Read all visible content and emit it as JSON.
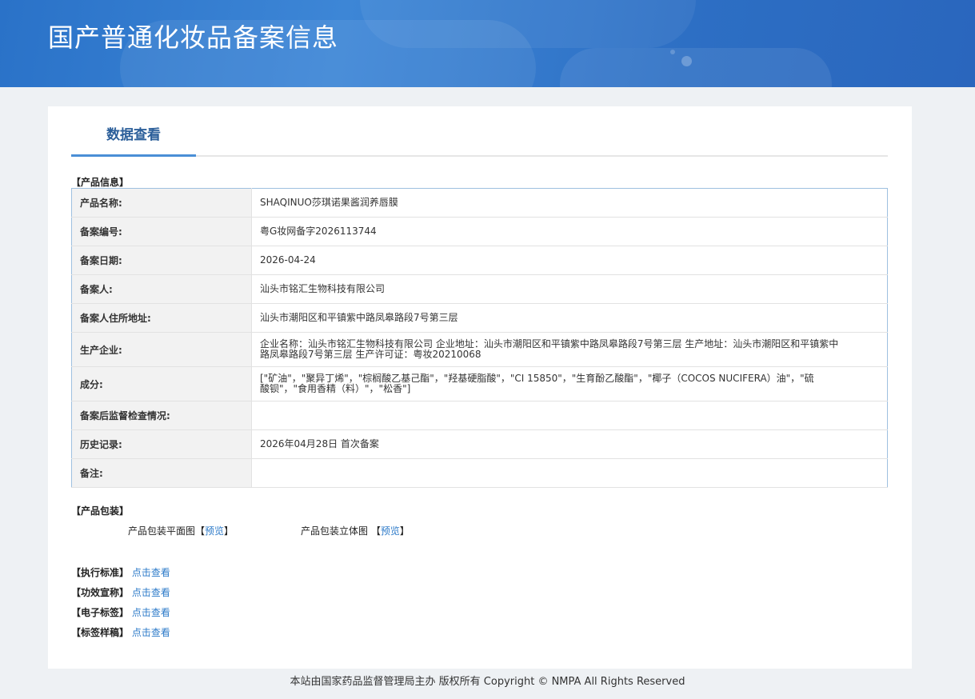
{
  "header": {
    "title": "国产普通化妆品备案信息"
  },
  "tab": {
    "label": "数据查看"
  },
  "sections": {
    "product_info": "【产品信息】",
    "packaging": "【产品包装】"
  },
  "product_table": [
    {
      "key": "产品名称:",
      "value": "SHAQINUO莎琪诺果酱润养唇膜"
    },
    {
      "key": "备案编号:",
      "value": "粤G妆网备字2026113744"
    },
    {
      "key": "备案日期:",
      "value": "2026-04-24"
    },
    {
      "key": "备案人:",
      "value": "汕头市铭汇生物科技有限公司"
    },
    {
      "key": "备案人住所地址:",
      "value": "汕头市潮阳区和平镇紫中路凤皋路段7号第三层"
    },
    {
      "key": "生产企业:",
      "value": "企业名称：汕头市铭汇生物科技有限公司 企业地址：汕头市潮阳区和平镇紫中路凤皋路段7号第三层 生产地址：汕头市潮阳区和平镇紫中路凤皋路段7号第三层 生产许可证：粤妆20210068"
    },
    {
      "key": "成分:",
      "value": "[\"矿油\"，\"聚异丁烯\"，\"棕榈酸乙基己酯\"，\"羟基硬脂酸\"，\"CI 15850\"，\"生育酚乙酸酯\"，\"椰子（COCOS NUCIFERA）油\"，\"硫酸钡\"，\"食用香精（料）\"，\"松香\"]"
    },
    {
      "key": "备案后监督检查情况:",
      "value": ""
    },
    {
      "key": "历史记录:",
      "value": "2026年04月28日 首次备案"
    },
    {
      "key": "备注:",
      "value": ""
    }
  ],
  "packaging": {
    "flat_label": "产品包装平面图",
    "flat_open": "【",
    "flat_link": "预览",
    "flat_close": "】",
    "stereo_label": "产品包装立体图",
    "stereo_open": "【",
    "stereo_link": "预览",
    "stereo_close": "】"
  },
  "links": [
    {
      "label": "【执行标准】",
      "link": "点击查看"
    },
    {
      "label": "【功效宣称】",
      "link": "点击查看"
    },
    {
      "label": "【电子标签】",
      "link": "点击查看"
    },
    {
      "label": "【标签样稿】",
      "link": "点击查看"
    }
  ],
  "footer": {
    "text": "本站由国家药品监督管理局主办 版权所有 Copyright © NMPA All Rights Reserved"
  }
}
